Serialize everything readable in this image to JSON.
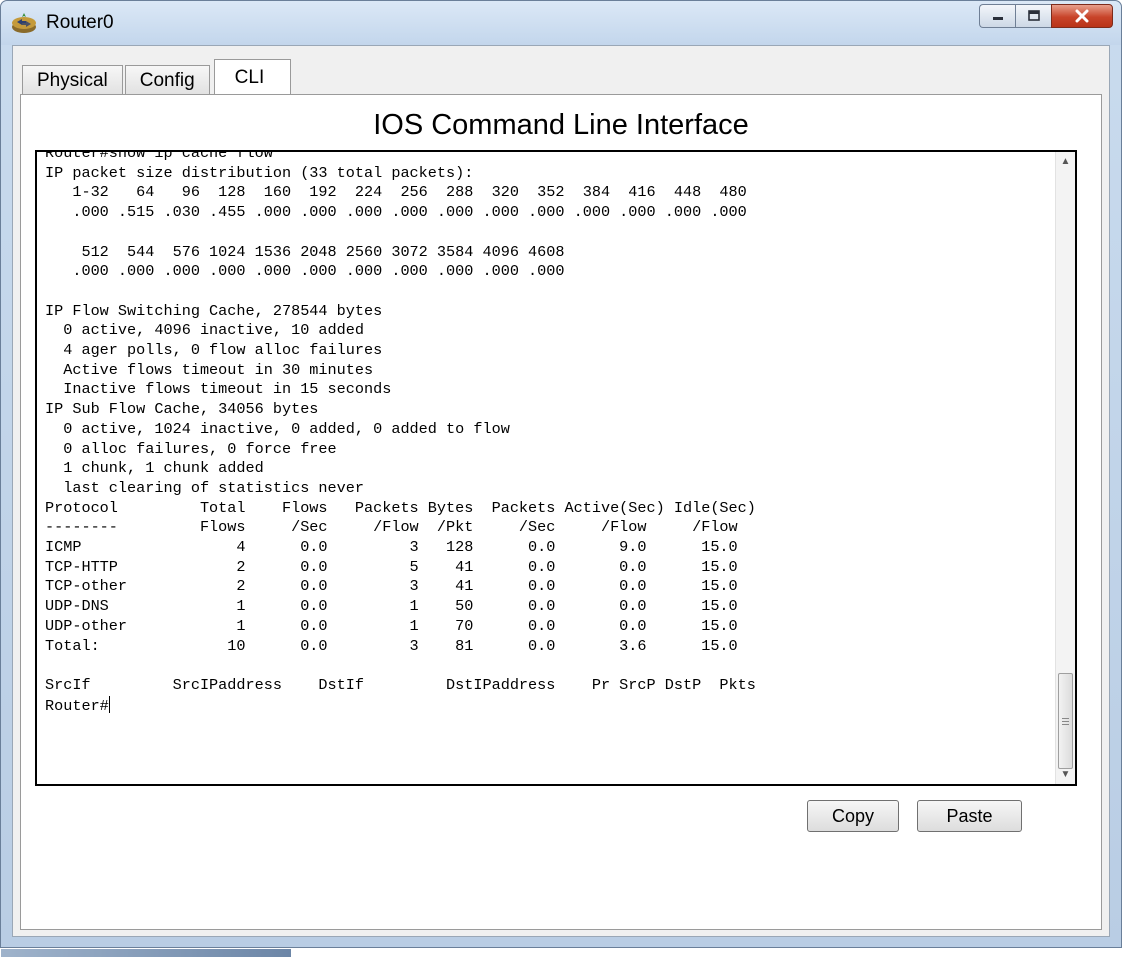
{
  "window": {
    "title": "Router0",
    "app_icon": "router-icon",
    "controls": [
      "minimize-icon",
      "maximize-icon",
      "close-icon"
    ],
    "accent_color": "#c8442a"
  },
  "tabs": [
    {
      "label": "Physical",
      "active": false
    },
    {
      "label": "Config",
      "active": false
    },
    {
      "label": "CLI",
      "active": true
    }
  ],
  "cli": {
    "heading": "IOS Command Line Interface",
    "output_lines": [
      "Router#show ip cache flow",
      "IP packet size distribution (33 total packets):",
      "   1-32   64   96  128  160  192  224  256  288  320  352  384  416  448  480",
      "   .000 .515 .030 .455 .000 .000 .000 .000 .000 .000 .000 .000 .000 .000 .000",
      "",
      "    512  544  576 1024 1536 2048 2560 3072 3584 4096 4608",
      "   .000 .000 .000 .000 .000 .000 .000 .000 .000 .000 .000",
      "",
      "IP Flow Switching Cache, 278544 bytes",
      "  0 active, 4096 inactive, 10 added",
      "  4 ager polls, 0 flow alloc failures",
      "  Active flows timeout in 30 minutes",
      "  Inactive flows timeout in 15 seconds",
      "IP Sub Flow Cache, 34056 bytes",
      "  0 active, 1024 inactive, 0 added, 0 added to flow",
      "  0 alloc failures, 0 force free",
      "  1 chunk, 1 chunk added",
      "  last clearing of statistics never",
      "Protocol         Total    Flows   Packets Bytes  Packets Active(Sec) Idle(Sec)",
      "--------         Flows     /Sec     /Flow  /Pkt     /Sec     /Flow     /Flow",
      "ICMP                 4      0.0         3   128      0.0       9.0      15.0",
      "TCP-HTTP             2      0.0         5    41      0.0       0.0      15.0",
      "TCP-other            2      0.0         3    41      0.0       0.0      15.0",
      "UDP-DNS              1      0.0         1    50      0.0       0.0      15.0",
      "UDP-other            1      0.0         1    70      0.0       0.0      15.0",
      "Total:              10      0.0         3    81      0.0       3.6      15.0",
      "",
      "SrcIf         SrcIPaddress    DstIf         DstIPaddress    Pr SrcP DstP  Pkts"
    ],
    "prompt": "Router#",
    "scroll_position": 0.95
  },
  "buttons": {
    "copy": "Copy",
    "paste": "Paste"
  }
}
